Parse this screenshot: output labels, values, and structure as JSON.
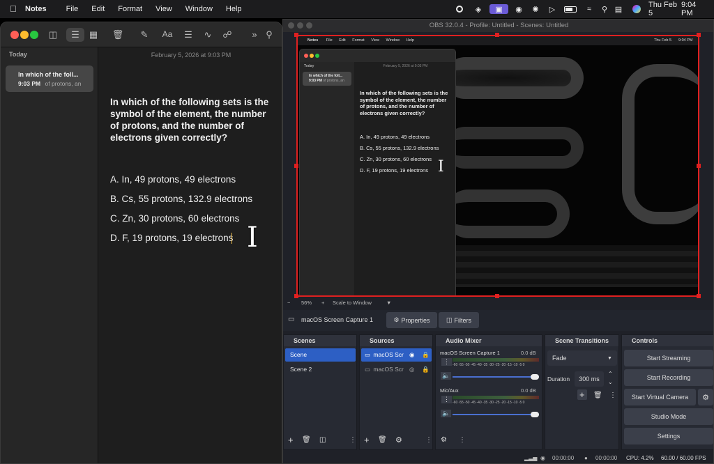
{
  "menubar": {
    "app_name": "Notes",
    "items": [
      "File",
      "Edit",
      "Format",
      "View",
      "Window",
      "Help"
    ],
    "date": "Thu Feb 5",
    "time": "9:04 PM"
  },
  "notes": {
    "sidebar_section": "Today",
    "note_item": {
      "title": "In which of the foll...",
      "time": "9:03 PM",
      "preview": "of protons, an"
    },
    "timestamp": "February 5, 2026 at 9:03 PM",
    "question": "In which of the following sets is the symbol of the element, the number of protons, and the number of electrons given correctly?",
    "options": [
      "A. In, 49 protons, 49 electrons",
      "B. Cs, 55 protons, 132.9 electrons",
      "C. Zn, 30 protons, 60 electrons",
      "D. F, 19 protons, 19 electrons"
    ]
  },
  "obs": {
    "title": "OBS 32.0.4 - Profile: Untitled - Scenes: Untitled",
    "zoom": "56%",
    "scale_mode": "Scale to Window",
    "source_label": "macOS Screen Capture 1",
    "properties": "Properties",
    "filters": "Filters",
    "scenes_title": "Scenes",
    "scenes": [
      "Scene",
      "Scene 2"
    ],
    "sources_title": "Sources",
    "sources": [
      "macOS Scr",
      "macOS Scr"
    ],
    "mixer_title": "Audio Mixer",
    "mixer": [
      {
        "name": "macOS Screen Capture 1",
        "db": "0.0 dB",
        "level": 0.0
      },
      {
        "name": "Mic/Aux",
        "db": "0.0 dB",
        "level": 0.0
      }
    ],
    "ticks": "-60 -55 -50 -45 -40 -35 -30 -25 -20 -15 -10 -5 0",
    "transitions_title": "Scene Transitions",
    "transition": "Fade",
    "duration_label": "Duration",
    "duration": "300 ms",
    "controls_title": "Controls",
    "controls": [
      "Start Streaming",
      "Start Recording",
      "Start Virtual Camera",
      "Studio Mode",
      "Settings"
    ],
    "status": {
      "stream_time": "00:00:00",
      "rec_time": "00:00:00",
      "cpu": "CPU: 4.2%",
      "fps": "60.00 / 60.00 FPS"
    }
  },
  "colors": {
    "accent": "#3b63c9",
    "record_red": "#e02020"
  }
}
